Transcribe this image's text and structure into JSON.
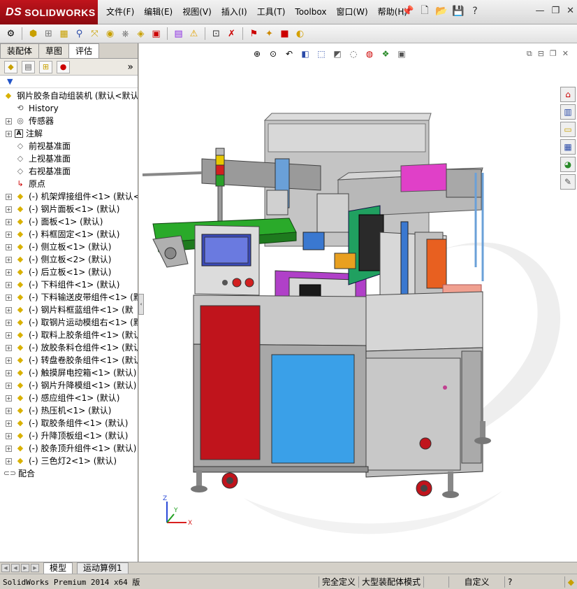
{
  "app": {
    "name": "SOLIDWORKS",
    "brand_color": "#c0141c"
  },
  "menus": [
    "文件(F)",
    "编辑(E)",
    "视图(V)",
    "插入(I)",
    "工具(T)",
    "Toolbox",
    "窗口(W)",
    "帮助(H)"
  ],
  "top_icons": [
    "pin-icon",
    "new-document-icon",
    "open-icon",
    "save-icon",
    "help-icon"
  ],
  "window_controls": [
    "minimize-icon",
    "restore-icon",
    "close-icon"
  ],
  "panel_tabs": [
    "装配体",
    "草图",
    "评估"
  ],
  "panel_active_tab": "评估",
  "tree": {
    "root": "钢片胶条自动组装机  (默认<默认",
    "fixed": [
      {
        "label": "History",
        "icon": "history-icon"
      },
      {
        "label": "传感器",
        "icon": "sensor-icon"
      },
      {
        "label": "注解",
        "icon": "annotation-icon"
      },
      {
        "label": "前视基准面",
        "icon": "plane-icon"
      },
      {
        "label": "上视基准面",
        "icon": "plane-icon"
      },
      {
        "label": "右视基准面",
        "icon": "plane-icon"
      },
      {
        "label": "原点",
        "icon": "origin-icon"
      }
    ],
    "components": [
      "(-) 机架焊接组件<1> (默认<",
      "(-) 钢片面板<1> (默认)",
      "(-) 面板<1> (默认)",
      "(-) 料框固定<1> (默认)",
      "(-) 侧立板<1> (默认)",
      "(-) 侧立板<2> (默认)",
      "(-) 后立板<1> (默认)",
      "(-) 下料组件<1> (默认)",
      "(-) 下料输送皮带组件<1> (默",
      "(-) 钢片料框蓝组件<1> (默",
      "(-) 取钢片运动模组右<1> (默",
      "(-) 取料上胶条组件<1> (默认",
      "(-) 放胶条料仓组件<1> (默认",
      "(-) 转盘卷胶条组件<1> (默认",
      "(-) 触摸屏电控箱<1> (默认)",
      "(-) 钢片升降模组<1> (默认)",
      "(-) 感应组件<1> (默认)",
      "(-) 热压机<1> (默认)",
      "(-) 取胶条组件<1> (默认)",
      "(-) 升降顶板组<1> (默认)",
      "(-) 胶条顶升组件<1> (默认)",
      "(-) 三色灯2<1> (默认)"
    ],
    "mates": "配合"
  },
  "bottom_tabs": [
    "模型",
    "运动算例1"
  ],
  "status": {
    "text": "SolidWorks Premium 2014 x64 版",
    "state": "完全定义",
    "mode": "大型装配体模式",
    "custom": "自定义"
  },
  "triad": {
    "x": "X",
    "y": "Y",
    "z": "Z"
  }
}
